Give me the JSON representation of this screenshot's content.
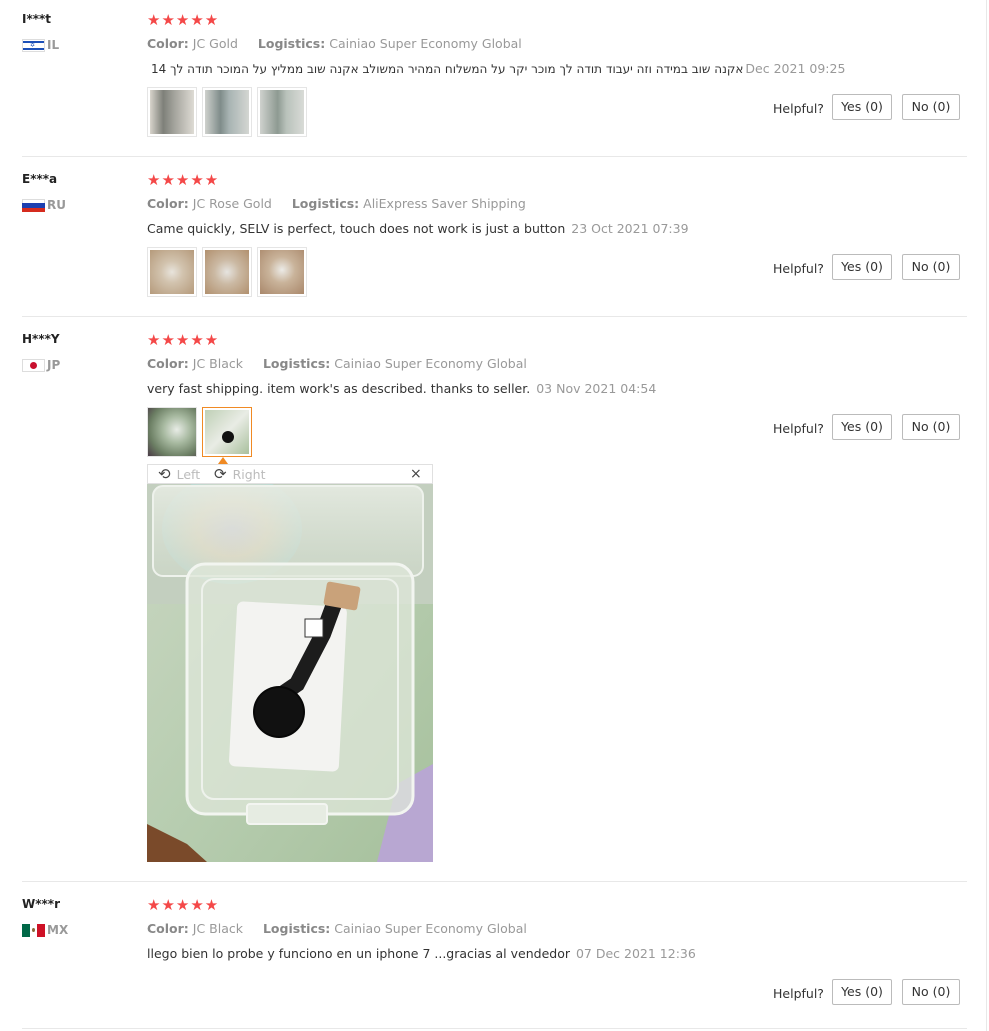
{
  "labels": {
    "color": "Color:",
    "logistics": "Logistics:",
    "helpful": "Helpful?"
  },
  "reviews": [
    {
      "user": "I***t",
      "country": "IL",
      "stars": "★★★★★",
      "color": "JC Gold",
      "logistics": "Cainiao Super Economy Global",
      "text": "אקנה שוב במידה וזה יעבוד תודה לך מוכר יקר על המשלוח המהיר המשולב אקנה שוב ממליץ על המוכר תודה לך 14",
      "date": "Dec 2021 09:25",
      "yes": "Yes (0)",
      "no": "No (0)"
    },
    {
      "user": "E***a",
      "country": "RU",
      "stars": "★★★★★",
      "color": "JC Rose Gold",
      "logistics": "AliExpress Saver Shipping",
      "text": "Came quickly, SELV is perfect, touch does not work is just a button",
      "date": "23 Oct 2021 07:39",
      "yes": "Yes (0)",
      "no": "No (0)"
    },
    {
      "user": "H***Y",
      "country": "JP",
      "stars": "★★★★★",
      "color": "JC Black",
      "logistics": "Cainiao Super Economy Global",
      "text": "very fast shipping. item work's as described. thanks to seller.",
      "date": "03 Nov 2021 04:54",
      "yes": "Yes (0)",
      "no": "No (0)"
    },
    {
      "user": "W***r",
      "country": "MX",
      "stars": "★★★★★",
      "color": "JC Black",
      "logistics": "Cainiao Super Economy Global",
      "text": "llego bien lo probe y funciono en un iphone 7 ...gracias al vendedor",
      "date": "07 Dec 2021 12:36",
      "yes": "Yes (0)",
      "no": "No (0)"
    }
  ],
  "viewer": {
    "left_label": "Left",
    "right_label": "Right",
    "close_glyph": "×",
    "rotate_left_icon": "⟲",
    "rotate_right_icon": "⟳"
  },
  "colors": {
    "star": "#f44848",
    "active_border": "#f08a24",
    "muted": "#999999"
  }
}
